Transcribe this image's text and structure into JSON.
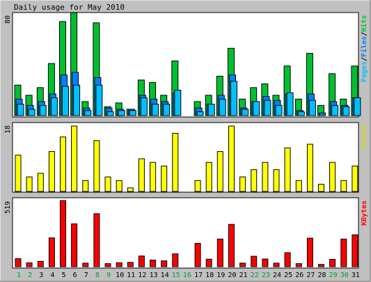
{
  "title": "Daily usage for May 2010",
  "colors": {
    "hits": "#00c030",
    "files": "#0080ff",
    "pages": "#00c0ff",
    "visits": "#ffff00",
    "kbytes": "#ff0000",
    "weekend_label": "#00a030",
    "weekday_label": "#000000",
    "frame_bg": "#c0c0c0",
    "panel_bg": "#ffffff"
  },
  "legend": {
    "pages": "Pages",
    "files": "Files",
    "hits": "Hits",
    "sep1": "/",
    "sep2": "/",
    "visits": "Visits",
    "kbytes": "KBytes"
  },
  "chart_data": [
    {
      "type": "bar",
      "panel": "hits-files-pages",
      "categories": [
        "1",
        "2",
        "3",
        "4",
        "5",
        "6",
        "7",
        "8",
        "9",
        "10",
        "11",
        "12",
        "13",
        "14",
        "15",
        "16",
        "17",
        "18",
        "19",
        "20",
        "21",
        "22",
        "23",
        "24",
        "25",
        "26",
        "27",
        "28",
        "29",
        "30",
        "31"
      ],
      "weekend_days": [
        "1",
        "2",
        "8",
        "9",
        "15",
        "16",
        "22",
        "23",
        "29",
        "30"
      ],
      "ymax_label": "80",
      "ylim": [
        0,
        80
      ],
      "series": [
        {
          "name": "Hits",
          "values": [
            24,
            16,
            22,
            41,
            74,
            81,
            11,
            73,
            7,
            10,
            5,
            28,
            26,
            16,
            43,
            0,
            11,
            16,
            31,
            53,
            13,
            22,
            25,
            16,
            39,
            13,
            49,
            8,
            33,
            13,
            39
          ]
        },
        {
          "name": "Files",
          "values": [
            13,
            8,
            11,
            17,
            32,
            34,
            6,
            30,
            6,
            5,
            5,
            16,
            13,
            11,
            18,
            0,
            6,
            9,
            16,
            32,
            6,
            11,
            15,
            12,
            17,
            4,
            17,
            2,
            11,
            8,
            14
          ]
        },
        {
          "name": "Pages",
          "values": [
            9,
            5,
            8,
            14,
            23,
            24,
            4,
            24,
            3,
            4,
            4,
            14,
            9,
            9,
            20,
            0,
            3,
            9,
            13,
            27,
            5,
            11,
            12,
            8,
            18,
            3,
            12,
            0,
            8,
            7,
            14
          ]
        }
      ]
    },
    {
      "type": "bar",
      "panel": "visits",
      "categories": [
        "1",
        "2",
        "3",
        "4",
        "5",
        "6",
        "7",
        "8",
        "9",
        "10",
        "11",
        "12",
        "13",
        "14",
        "15",
        "16",
        "17",
        "18",
        "19",
        "20",
        "21",
        "22",
        "23",
        "24",
        "25",
        "26",
        "27",
        "28",
        "29",
        "30",
        "31"
      ],
      "ymax_label": "18",
      "ylim": [
        0,
        18
      ],
      "series": [
        {
          "name": "Visits",
          "values": [
            10,
            4,
            5,
            11,
            15,
            18,
            3,
            14,
            4,
            3,
            1,
            9,
            8,
            7,
            16,
            0,
            3,
            8,
            11,
            18,
            4,
            6,
            8,
            6,
            12,
            3,
            13,
            2,
            8,
            3,
            7
          ]
        }
      ]
    },
    {
      "type": "bar",
      "panel": "kbytes",
      "categories": [
        "1",
        "2",
        "3",
        "4",
        "5",
        "6",
        "7",
        "8",
        "9",
        "10",
        "11",
        "12",
        "13",
        "14",
        "15",
        "16",
        "17",
        "18",
        "19",
        "20",
        "21",
        "22",
        "23",
        "24",
        "25",
        "26",
        "27",
        "28",
        "29",
        "30",
        "31"
      ],
      "ymax_label": "519",
      "ylim": [
        0,
        519
      ],
      "series": [
        {
          "name": "KBytes",
          "values": [
            63,
            30,
            42,
            226,
            519,
            336,
            28,
            416,
            24,
            31,
            34,
            84,
            52,
            46,
            101,
            0,
            183,
            59,
            217,
            332,
            28,
            82,
            60,
            28,
            110,
            24,
            224,
            18,
            58,
            217,
            250
          ]
        }
      ]
    }
  ]
}
